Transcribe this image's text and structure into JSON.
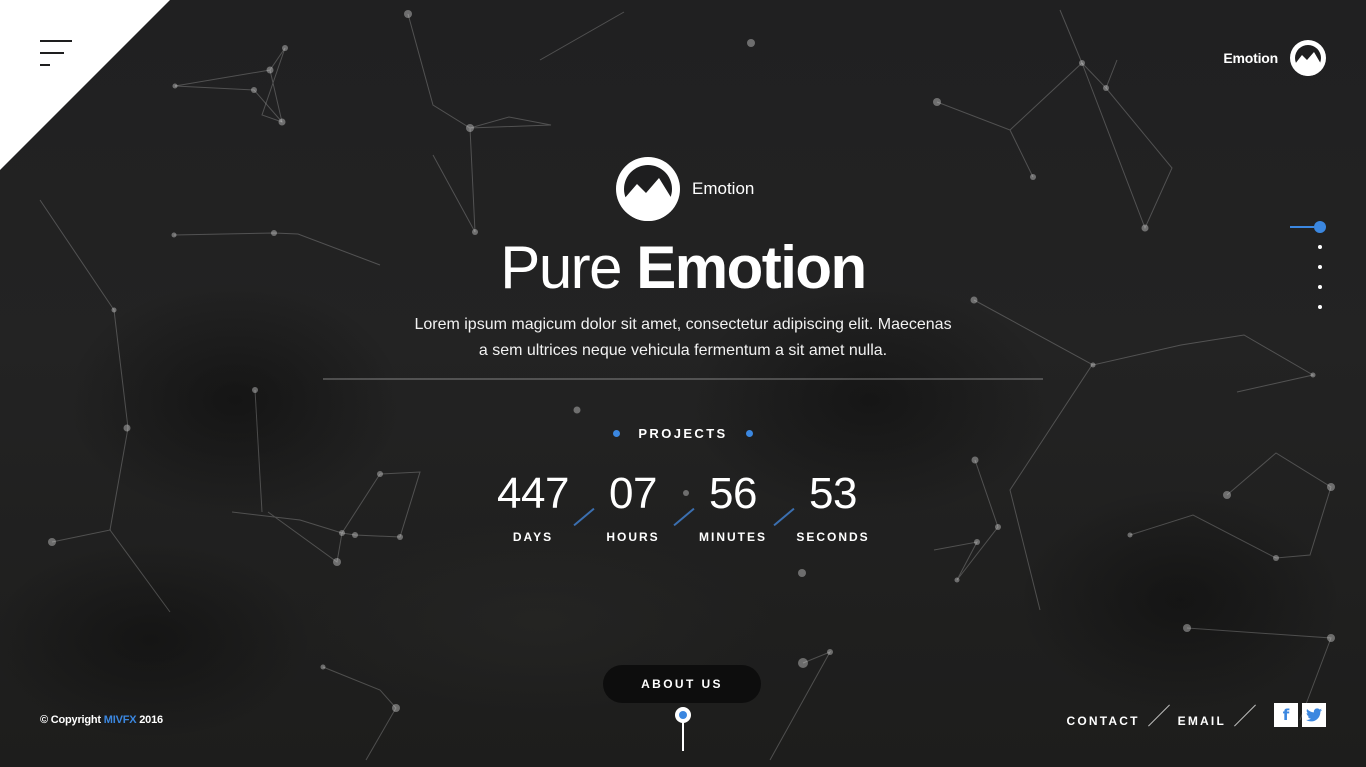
{
  "brand": {
    "name": "Emotion"
  },
  "hero": {
    "logo_name": "Emotion",
    "title_light": "Pure",
    "title_bold": "Emotion",
    "subtitle_line1": "Lorem ipsum magicum dolor sit amet, consectetur adipiscing elit. Maecenas",
    "subtitle_line2": "a sem ultrices neque vehicula fermentum a sit amet nulla."
  },
  "projects_label": "PROJECTS",
  "countdown": [
    {
      "value": "447",
      "label": "DAYS"
    },
    {
      "value": "07",
      "label": "HOURS"
    },
    {
      "value": "56",
      "label": "MINUTES"
    },
    {
      "value": "53",
      "label": "SECONDS"
    }
  ],
  "about_button": "ABOUT US",
  "footer": {
    "copyright_prefix": "© Copyright",
    "copyright_brand": "MIVFX",
    "copyright_year": "2016",
    "links": [
      "CONTACT",
      "EMAIL"
    ],
    "social": [
      {
        "icon": "facebook-icon",
        "glyph": "f"
      },
      {
        "icon": "twitter-icon",
        "glyph": "t"
      }
    ]
  },
  "side_nav": {
    "count": 5,
    "active": 0
  },
  "colors": {
    "accent": "#3b87e0",
    "background": "#1e1e1f",
    "corner": "#ffffff"
  }
}
